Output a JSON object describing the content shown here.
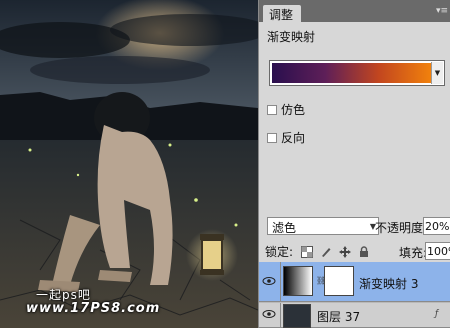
{
  "watermark": {
    "line1": "一起ps吧",
    "line2": "www.17PS8.com"
  },
  "panel": {
    "tab_label": "调整",
    "menu_icon": "panel-menu-icon",
    "adjustment_title": "渐变映射",
    "gradient": {
      "colors": [
        "#2a0f4e",
        "#5e1f58",
        "#c2461f",
        "#f2820c"
      ]
    },
    "dither_label": "仿色",
    "reverse_label": "反向"
  },
  "layers_panel": {
    "blend_mode": "滤色",
    "opacity_label": "不透明度:",
    "opacity_value": "20%",
    "lock_label": "锁定:",
    "fill_label": "填充:",
    "fill_value": "100%",
    "layers": [
      {
        "name": "渐变映射 3",
        "selected": true
      },
      {
        "name": "图层 37",
        "selected": false
      }
    ]
  },
  "colors": {
    "selected_layer": "#8db3ea",
    "panel_bg": "#d7d7d7"
  }
}
